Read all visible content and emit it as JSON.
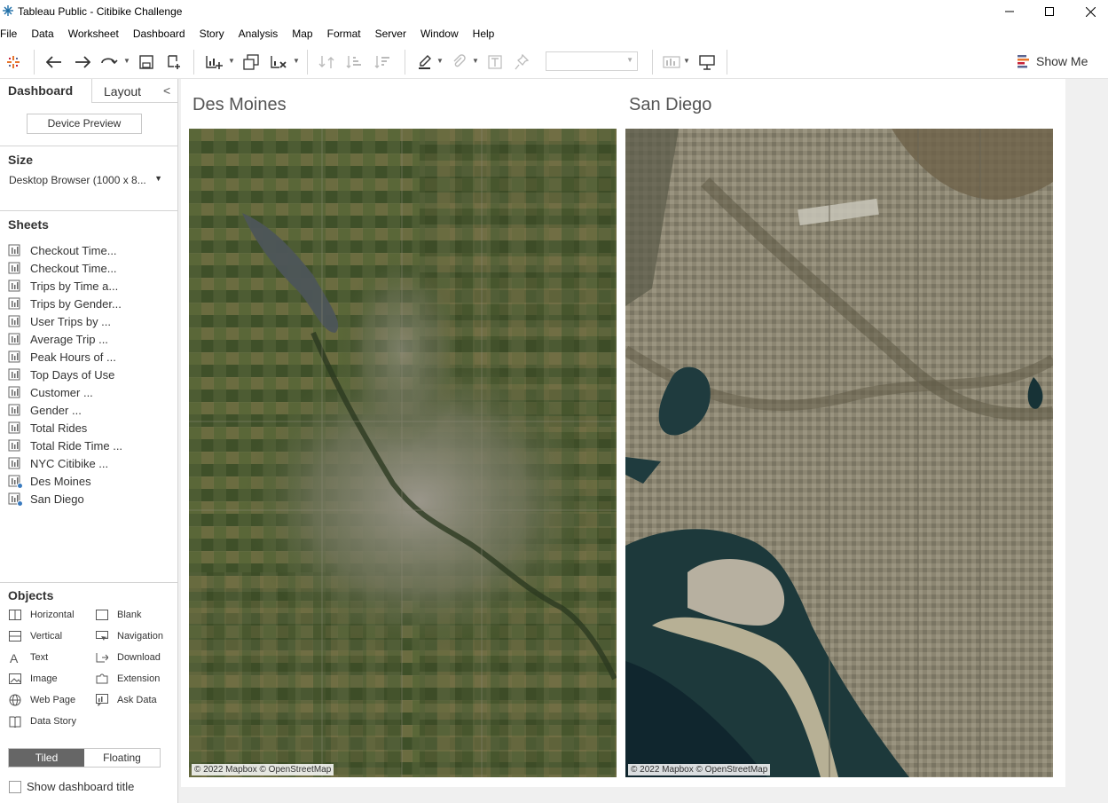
{
  "window": {
    "title": "Tableau Public - Citibike Challenge"
  },
  "menu": [
    "File",
    "Data",
    "Worksheet",
    "Dashboard",
    "Story",
    "Analysis",
    "Map",
    "Format",
    "Server",
    "Window",
    "Help"
  ],
  "toolbar": {
    "show_me_label": "Show Me",
    "icons": [
      "tableau-logo-icon",
      "undo-icon",
      "redo-icon",
      "replay-icon",
      "save-icon",
      "new-data-source-icon",
      "new-worksheet-icon",
      "duplicate-icon",
      "clear-icon",
      "swap-icon",
      "sort-ascending-icon",
      "sort-descending-icon",
      "highlight-icon",
      "group-icon",
      "labels-icon",
      "pin-icon",
      "fit-icon",
      "presentation-icon"
    ]
  },
  "left_pane": {
    "tab_dashboard": "Dashboard",
    "tab_layout": "Layout",
    "collapse_glyph": "<",
    "device_preview_label": "Device Preview",
    "size": {
      "title": "Size",
      "value": "Desktop Browser (1000 x 8..."
    },
    "sheets": {
      "title": "Sheets",
      "items": [
        {
          "label": "Checkout Time...",
          "in_dashboard": false
        },
        {
          "label": "Checkout Time...",
          "in_dashboard": false
        },
        {
          "label": "Trips by Time a...",
          "in_dashboard": false
        },
        {
          "label": "Trips by Gender...",
          "in_dashboard": false
        },
        {
          "label": "User Trips by ...",
          "in_dashboard": false
        },
        {
          "label": "Average Trip ...",
          "in_dashboard": false
        },
        {
          "label": "Peak Hours of ...",
          "in_dashboard": false
        },
        {
          "label": "Top Days of Use",
          "in_dashboard": false
        },
        {
          "label": "Customer ...",
          "in_dashboard": false
        },
        {
          "label": "Gender ...",
          "in_dashboard": false
        },
        {
          "label": "Total Rides",
          "in_dashboard": false
        },
        {
          "label": "Total Ride Time ...",
          "in_dashboard": false
        },
        {
          "label": "NYC Citibike ...",
          "in_dashboard": false
        },
        {
          "label": "Des Moines",
          "in_dashboard": true
        },
        {
          "label": "San Diego",
          "in_dashboard": true
        }
      ]
    },
    "objects": {
      "title": "Objects",
      "items": [
        {
          "label": "Horizontal",
          "icon": "horizontal-container-icon"
        },
        {
          "label": "Blank",
          "icon": "blank-icon"
        },
        {
          "label": "Vertical",
          "icon": "vertical-container-icon"
        },
        {
          "label": "Navigation",
          "icon": "navigation-icon"
        },
        {
          "label": "Text",
          "icon": "text-icon"
        },
        {
          "label": "Download",
          "icon": "download-icon"
        },
        {
          "label": "Image",
          "icon": "image-icon"
        },
        {
          "label": "Extension",
          "icon": "extension-icon"
        },
        {
          "label": "Web Page",
          "icon": "web-page-icon"
        },
        {
          "label": "Ask Data",
          "icon": "ask-data-icon"
        },
        {
          "label": "Data Story",
          "icon": "data-story-icon"
        }
      ]
    },
    "layout_mode": {
      "tiled": "Tiled",
      "floating": "Floating",
      "selected": "Tiled"
    },
    "show_dashboard_title": {
      "label": "Show dashboard title",
      "checked": false
    }
  },
  "dashboard": {
    "maps": [
      {
        "title": "Des Moines",
        "attribution": "© 2022 Mapbox © OpenStreetMap"
      },
      {
        "title": "San Diego",
        "attribution": "© 2022 Mapbox © OpenStreetMap"
      }
    ]
  },
  "colors": {
    "accent_blue": "#3a7bbf",
    "toggle_active": "#666666",
    "des_moines_terrain": "#4a5a32",
    "san_diego_urban": "#8a8570",
    "san_diego_water": "#1d3a3c"
  }
}
